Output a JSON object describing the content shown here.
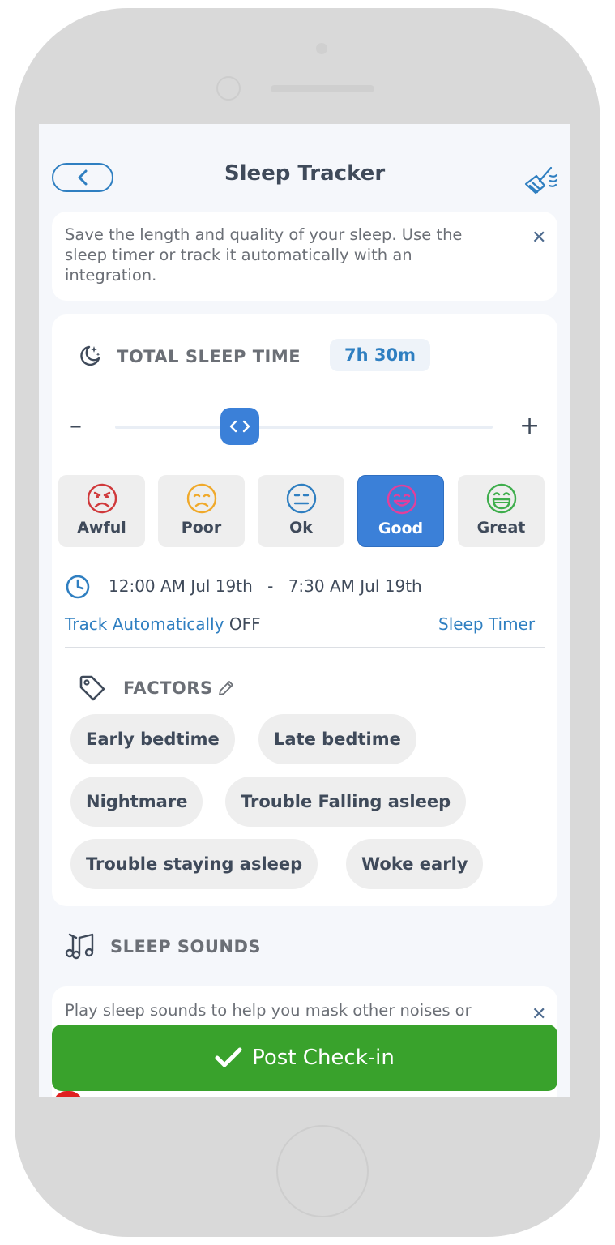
{
  "header": {
    "title": "Sleep Tracker"
  },
  "info": {
    "text": "Save the length and quality of your sleep. Use the sleep timer or track it automatically with an integration."
  },
  "total_sleep": {
    "label": "TOTAL SLEEP TIME",
    "value": "7h 30m",
    "minus": "–",
    "plus": "+",
    "slider_fraction": 0.33
  },
  "moods": [
    {
      "label": "Awful",
      "color": "#d0393b"
    },
    {
      "label": "Poor",
      "color": "#f0a92a"
    },
    {
      "label": "Ok",
      "color": "#2f7fc1"
    },
    {
      "label": "Good",
      "color": "#e23f9c",
      "selected": true
    },
    {
      "label": "Great",
      "color": "#3fae4d"
    }
  ],
  "time_range": {
    "start": "12:00 AM Jul 19th",
    "separator": "-",
    "end": "7:30 AM Jul 19th"
  },
  "tracking": {
    "auto_label": "Track Automatically",
    "auto_state": "OFF",
    "timer_label": "Sleep Timer"
  },
  "factors": {
    "label": "FACTORS",
    "chips": [
      "Early bedtime",
      "Late bedtime",
      "Nightmare",
      "Trouble Falling asleep",
      "Trouble staying asleep",
      "Woke early"
    ]
  },
  "sleep_sounds": {
    "label": "SLEEP SOUNDS",
    "info_text": "Play sleep sounds to help you mask other noises or"
  },
  "post_button": {
    "label": "Post Check-in"
  },
  "colors": {
    "accent": "#2f7fc1",
    "post": "#39a22c",
    "selected_mood": "#3b80d8"
  }
}
